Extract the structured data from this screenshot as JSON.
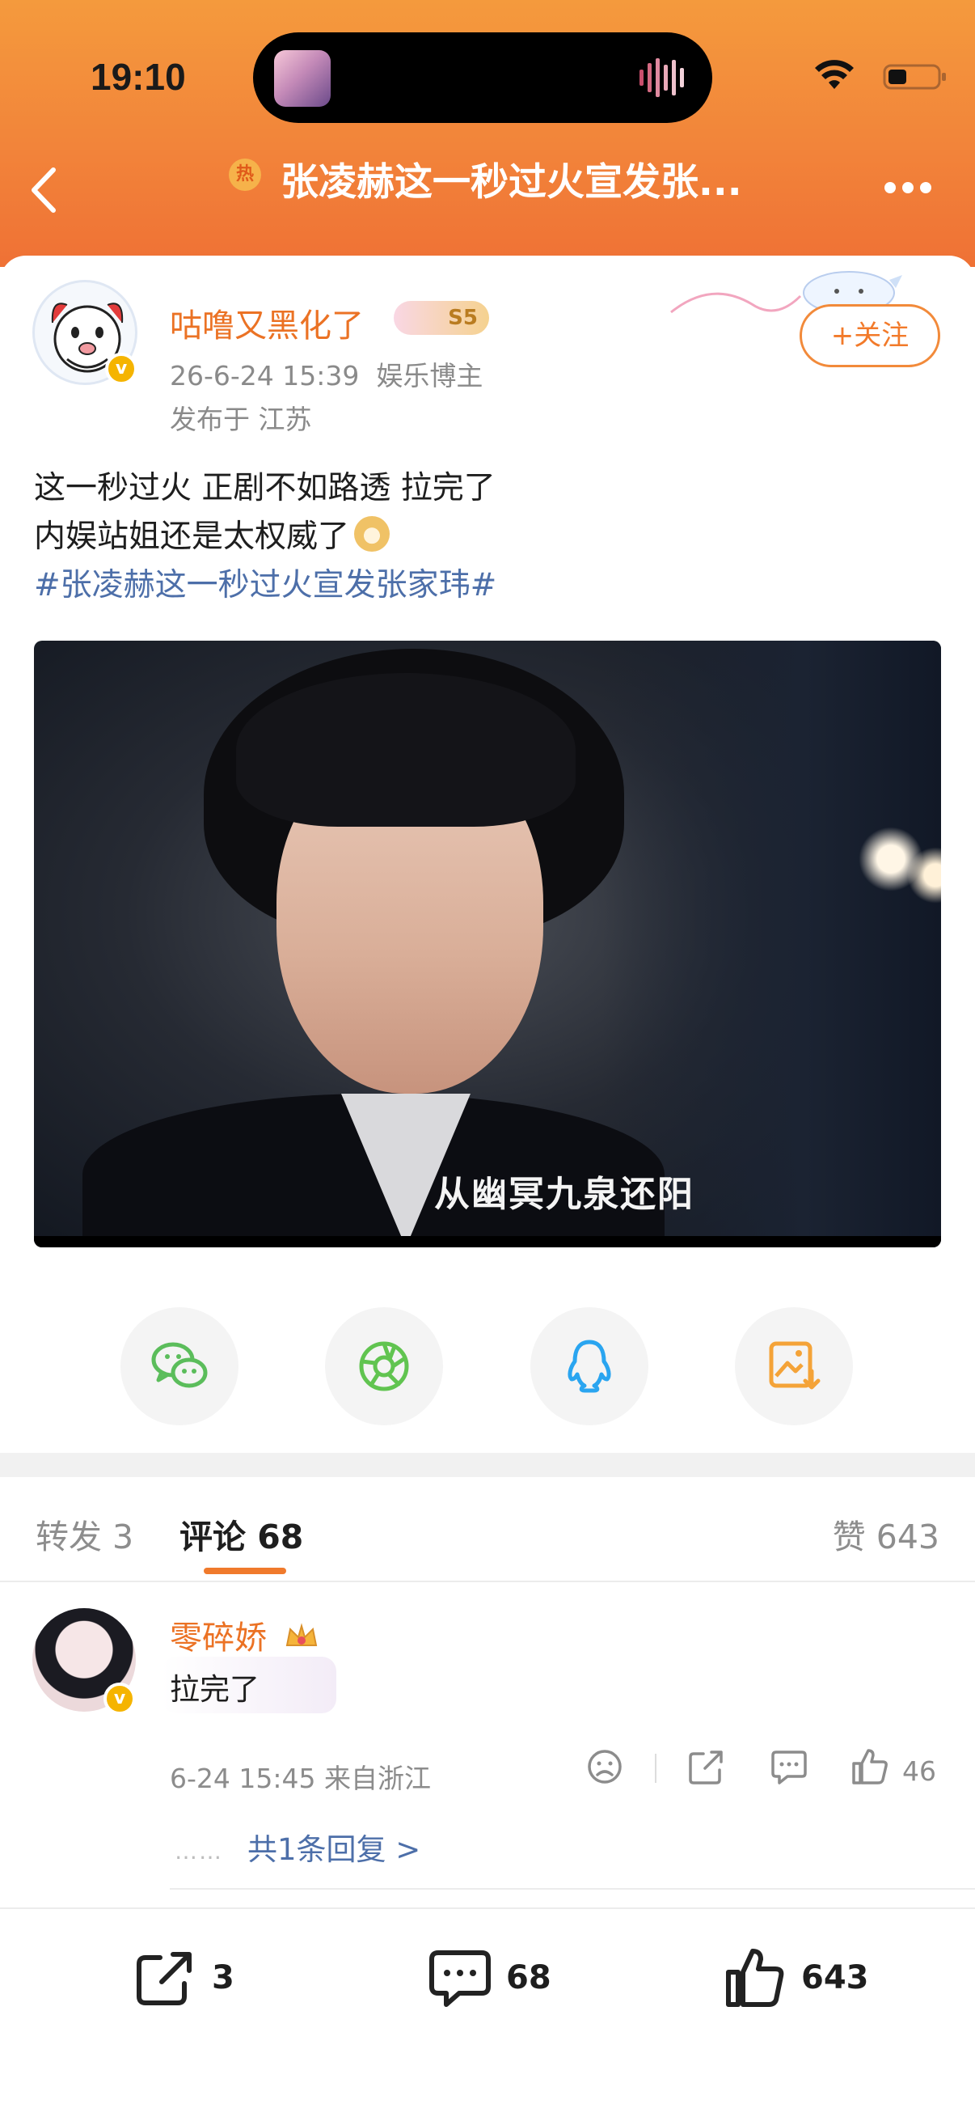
{
  "status_bar": {
    "time": "19:10"
  },
  "nav": {
    "hot_badge": "热",
    "title": "张凌赫这一秒过火宣发张..."
  },
  "author": {
    "name": "咕噜又黑化了",
    "level": "S5",
    "post_time": "26-6-24 15:39",
    "role": "娱乐博主",
    "location": "发布于 江苏",
    "follow_label": "+关注"
  },
  "post": {
    "line1": "这一秒过火 正剧不如路透 拉完了",
    "line2": "内娱站姐还是太权威了",
    "hashtag": "#张凌赫这一秒过火宣发张家玮#",
    "media_caption": "从幽冥九泉还阳"
  },
  "share_buttons": [
    {
      "icon": "wechat-icon",
      "color": "#5bbd5b"
    },
    {
      "icon": "moments-icon",
      "color": "#61c450"
    },
    {
      "icon": "qq-icon",
      "color": "#2aa5f0"
    },
    {
      "icon": "save-image-icon",
      "color": "#f4a338"
    }
  ],
  "tabs": {
    "repost": "转发 3",
    "comment": "评论 68",
    "like": "赞 643"
  },
  "comment": {
    "name": "零碎娇",
    "text": "拉完了",
    "meta": "6-24 15:45 来自浙江",
    "like_count": "46",
    "dots": "……",
    "replies": "共1条回复 >"
  },
  "bottom_bar": {
    "repost_count": "3",
    "comment_count": "68",
    "like_count": "643"
  },
  "colors": {
    "header_orange": "#f2843a",
    "accent_orange": "#eb7224",
    "link_blue": "#4d6fa9"
  }
}
